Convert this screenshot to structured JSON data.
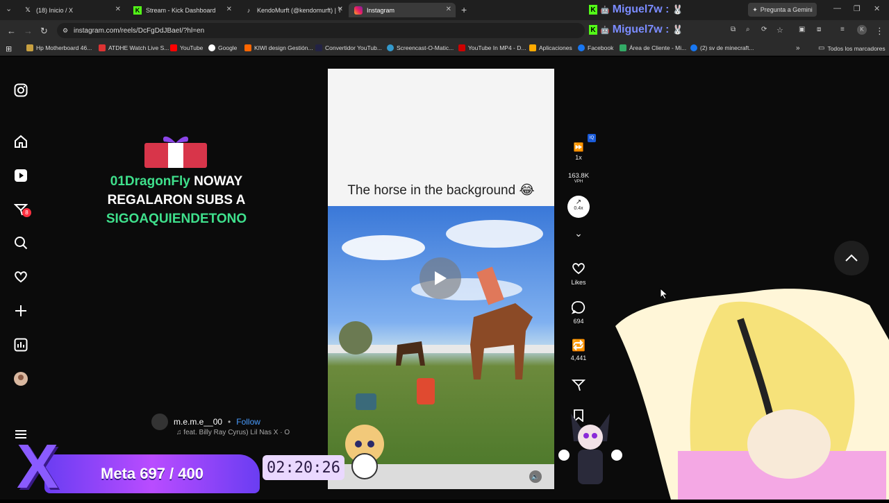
{
  "tabs": [
    {
      "label": "(18) Inicio / X",
      "icon": "x-logo-icon"
    },
    {
      "label": "Stream - Kick Dashboard",
      "icon": "kick-logo-icon"
    },
    {
      "label": "KendoMurft (@kendomurft) | T",
      "icon": "tiktok-logo-icon"
    },
    {
      "label": "Instagram",
      "icon": "instagram-logo-icon"
    }
  ],
  "gemini_label": "Pregunta a Gemini",
  "overlay_users": [
    "Miguel7w :",
    "Miguel7w :"
  ],
  "url": "instagram.com/reels/DcFgDdJBaeI/?hl=en",
  "bookmarks": [
    "Hp Motherboard 46...",
    "ATDHE Watch Live S...",
    "YouTube",
    "Google",
    "KIWI design Gestión...",
    "Convertidor YouTub...",
    "Screencast-O-Matic...",
    "YouTube In MP4 - D...",
    "Aplicaciones",
    "Facebook",
    "Área de Cliente - Mi...",
    "(2) sv de minecraft..."
  ],
  "bookmarks_all": "Todos los marcadores",
  "sidebar": {
    "notifications_badge": "8"
  },
  "alert": {
    "user": "01DragonFly",
    "line1": "NOWAY",
    "line2": "REGALARON SUBS A",
    "target": "SIGOAQUIENDETONO"
  },
  "reel": {
    "caption": "The horse in the background 😂"
  },
  "rail": {
    "speed": "1x",
    "vph_value": "163.8K",
    "vph_label": "VPH",
    "trend": "0.4x",
    "likes_label": "Likes",
    "comments": "694",
    "reposts": "4,441"
  },
  "poster": {
    "username": "m.e.m.e__00",
    "follow": "Follow",
    "music": "feat. Billy Ray Cyrus)   Lil Nas X · O"
  },
  "meta_goal": "Meta 697 / 400",
  "timer": "02:20:26"
}
